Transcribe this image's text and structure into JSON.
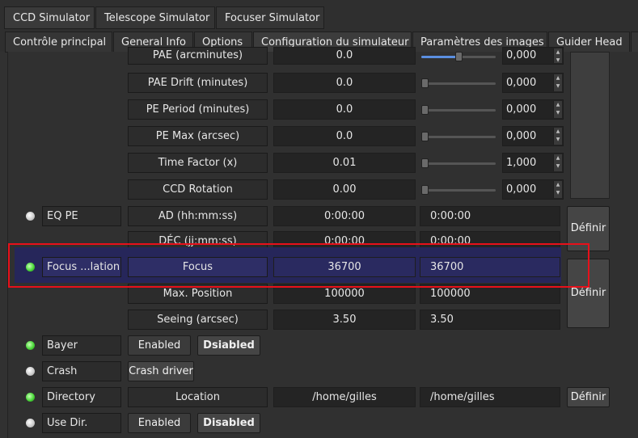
{
  "top_tabs": [
    {
      "label": "CCD Simulator",
      "active": true
    },
    {
      "label": "Telescope Simulator",
      "active": false
    },
    {
      "label": "Focuser Simulator",
      "active": false
    }
  ],
  "sub_tabs": [
    {
      "label": "Contrôle principal",
      "active": false
    },
    {
      "label": "General Info",
      "active": false
    },
    {
      "label": "Options",
      "active": false
    },
    {
      "label": "Configuration du simulateur",
      "active": true
    },
    {
      "label": "Paramètres des images",
      "active": false
    },
    {
      "label": "Guider Head",
      "active": false
    }
  ],
  "rows": {
    "pae": {
      "label": "PAE (arcminutes)",
      "value": "0.0",
      "spin": "0,000",
      "slider": 0.5
    },
    "pae_drift": {
      "label": "PAE Drift (minutes)",
      "value": "0.0",
      "spin": "0,000",
      "slider": 0
    },
    "pe_period": {
      "label": "PE Period (minutes)",
      "value": "0.0",
      "spin": "0,000",
      "slider": 0
    },
    "pe_max": {
      "label": "PE Max (arcsec)",
      "value": "0.0",
      "spin": "0,000",
      "slider": 0
    },
    "time_factor": {
      "label": "Time Factor (x)",
      "value": "0.01",
      "spin": "1,000",
      "slider": 0
    },
    "ccd_rotation": {
      "label": "CCD Rotation",
      "value": "0.00",
      "spin": "0,000",
      "slider": 0
    }
  },
  "eq_pe": {
    "group": "EQ PE",
    "ad_label": "AD (hh:mm:ss)",
    "ad_value": "0:00:00",
    "ad_input": "0:00:00",
    "dec_label": "DÉC (jj:mm:ss)",
    "dec_value": "0:00:00",
    "dec_input": "0:00:00",
    "button": "Définir"
  },
  "focus": {
    "group": "Focus ...lation",
    "focus_label": "Focus",
    "focus_value": "36700",
    "focus_input": "36700",
    "maxpos_label": "Max. Position",
    "maxpos_value": "100000",
    "maxpos_input": "100000",
    "seeing_label": "Seeing (arcsec)",
    "seeing_value": "3.50",
    "seeing_input": "3.50",
    "button": "Définir"
  },
  "bayer": {
    "group": "Bayer",
    "enabled": "Enabled",
    "disabled": "Dsiabled"
  },
  "crash": {
    "group": "Crash",
    "button": "Crash driver"
  },
  "directory": {
    "group": "Directory",
    "label": "Location",
    "value": "/home/gilles",
    "input": "/home/gilles",
    "button": "Définir"
  },
  "use_dir": {
    "group": "Use Dir.",
    "enabled": "Enabled",
    "disabled": "Disabled"
  },
  "colors": {
    "highlight": "#26265a",
    "selection_box": "#e8101a",
    "led_ok": "#4bd83a",
    "led_idle": "#d0d0d0"
  }
}
